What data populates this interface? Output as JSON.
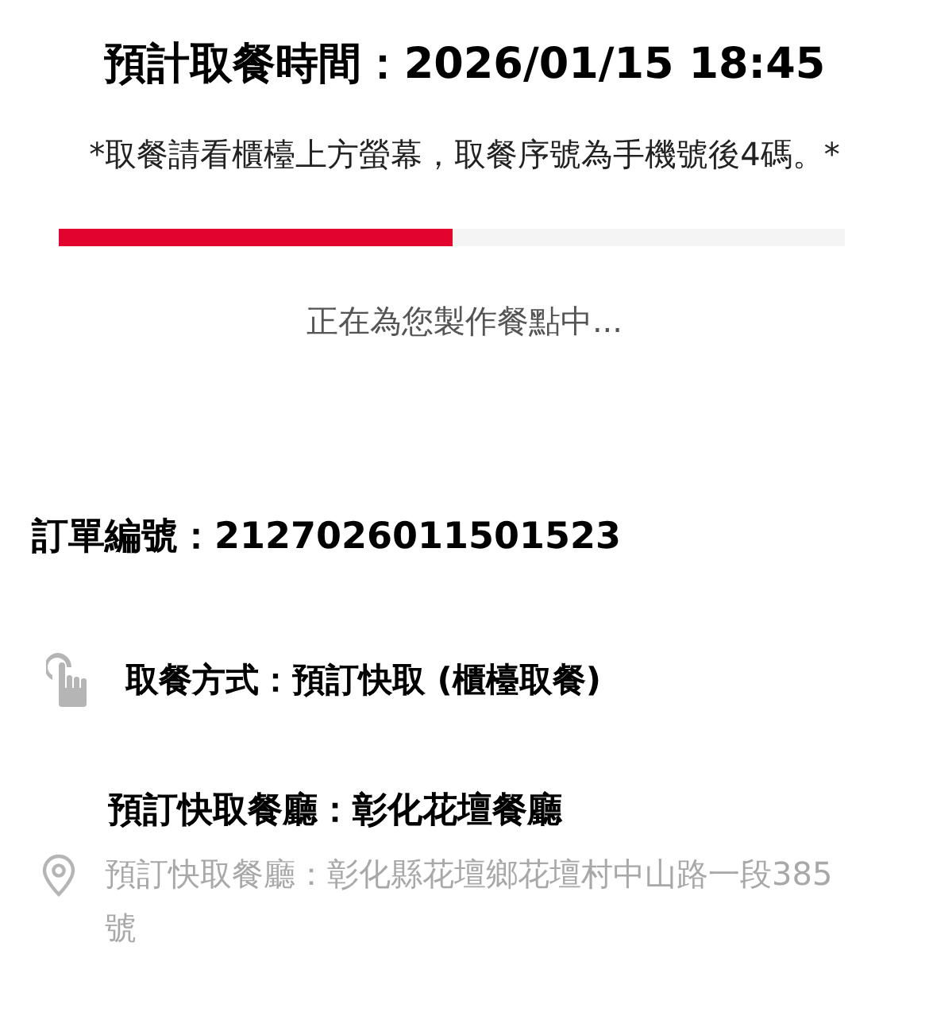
{
  "pickup_time": {
    "label": "預計取餐時間：",
    "value": "2026/01/15 18:45"
  },
  "note": "*取餐請看櫃檯上方螢幕，取餐序號為手機號後4碼。*",
  "progress": {
    "level": 0.5
  },
  "status": "正在為您製作餐點中...",
  "order_number": {
    "label": "訂單編號：",
    "value": "2127026011501523"
  },
  "pickup_method": "取餐方式：預訂快取 (櫃檯取餐)",
  "restaurant": {
    "name": "預訂快取餐廳：彰化花壇餐廳",
    "address": "預訂快取餐廳：彰化縣花壇鄉花壇村中山路一段385號"
  }
}
